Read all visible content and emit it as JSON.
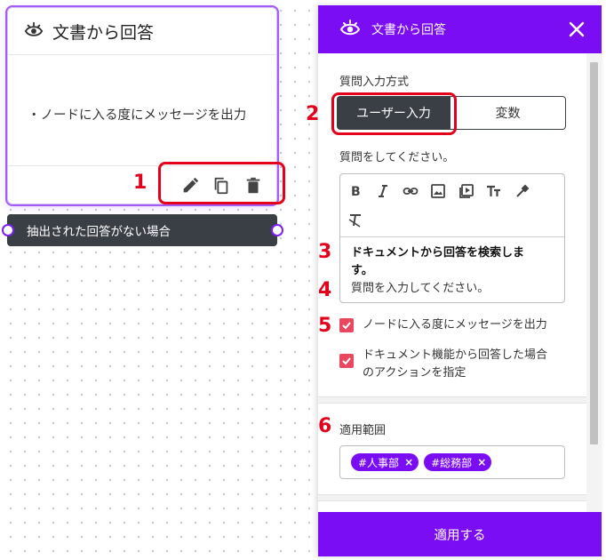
{
  "node": {
    "title": "文書から回答",
    "message": "・ノードに入る度にメッセージを出力",
    "branch_label": "抽出された回答がない場合",
    "toolbar_icons": [
      "pencil-icon",
      "copy-icon",
      "trash-icon"
    ]
  },
  "panel": {
    "title": "文書から回答",
    "input_method_label": "質問入力方式",
    "tabs": [
      {
        "label": "ユーザー入力",
        "active": true
      },
      {
        "label": "変数",
        "active": false
      }
    ],
    "question_label": "質問をしてください。",
    "editor_tools": [
      "bold-icon",
      "italic-icon",
      "link-icon",
      "image-icon",
      "video-icon",
      "text-size-icon",
      "color-picker-icon",
      "clear-format-icon"
    ],
    "editor_line1": "ドキュメントから回答を検索しま",
    "editor_line2": "す。",
    "editor_placeholder": "質問を入力してください。",
    "checkbox1": {
      "label": "ノードに入る度にメッセージを出力",
      "checked": true
    },
    "checkbox2": {
      "label_line1": "ドキュメント機能から回答した場合",
      "label_line2": "のアクションを指定",
      "checked": true
    },
    "scope_label": "適用範囲",
    "scope_tags": [
      "#人事部",
      "#総務部"
    ],
    "tag_remove": "×",
    "apply_label": "適用する"
  },
  "annotations": [
    "1",
    "2",
    "3",
    "4",
    "5",
    "6"
  ],
  "colors": {
    "accent_purple": "#7b0df5",
    "dark_button": "#3a3e45",
    "annotation_red": "#e3001b",
    "checkbox_pink": "#e8475f"
  }
}
